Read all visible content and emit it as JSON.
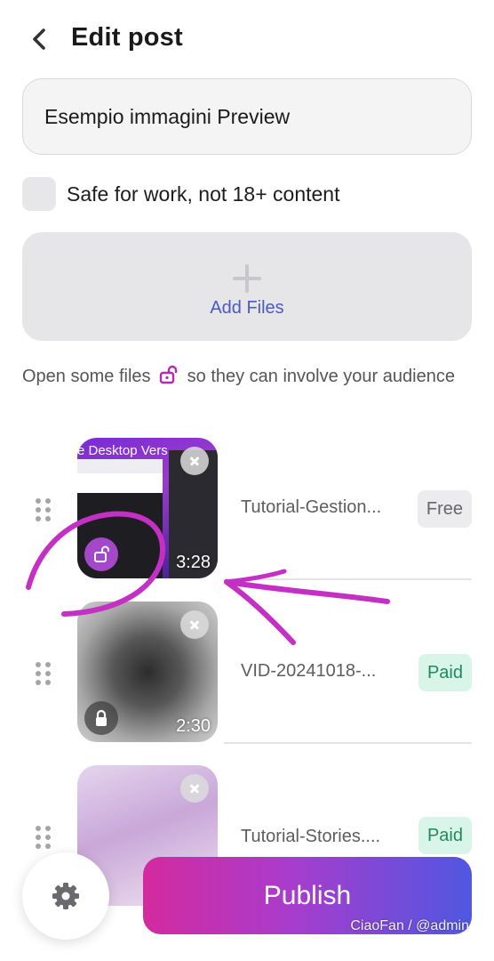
{
  "header": {
    "title": "Edit post",
    "back_icon": "chevron-left-icon"
  },
  "post": {
    "title_value": "Esempio immagini Preview"
  },
  "sfw": {
    "label": "Safe for work, not 18+ content",
    "checked": false
  },
  "add_files": {
    "label": "Add Files",
    "icon": "plus-icon"
  },
  "hint": {
    "before": "Open some files",
    "after": "so they can involve your audience",
    "icon": "unlock-icon"
  },
  "files": [
    {
      "name": "Tutorial-Gestion...",
      "duration": "3:28",
      "price_label": "Free",
      "locked": false,
      "thumb_text": "e Desktop   Vers"
    },
    {
      "name": "VID-20241018-...",
      "duration": "2:30",
      "price_label": "Paid",
      "locked": true
    },
    {
      "name": "Tutorial-Stories....",
      "price_label": "Paid",
      "locked": true
    }
  ],
  "footer": {
    "publish_label": "Publish",
    "settings_icon": "gear-icon",
    "watermark": "CiaoFan / @admin"
  },
  "colors": {
    "accent": "#4a59c9",
    "annotation": "#c42fc4",
    "paid_bg": "#d9f5ea",
    "paid_text": "#1f8a5f",
    "free_bg": "#ececee"
  }
}
